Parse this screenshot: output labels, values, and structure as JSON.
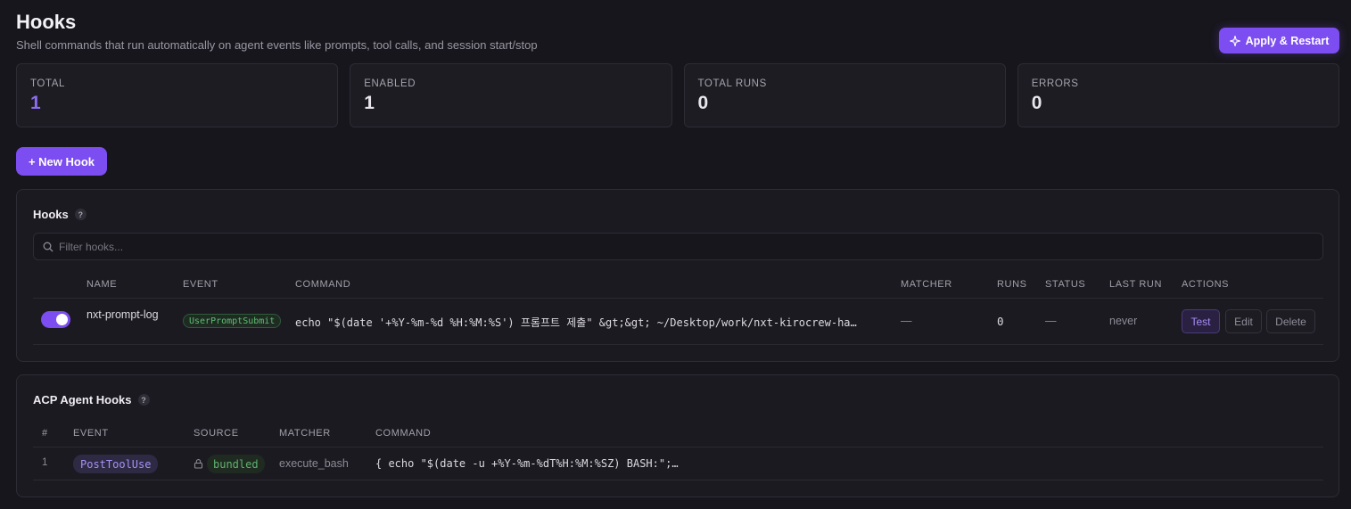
{
  "header": {
    "title": "Hooks",
    "subtitle": "Shell commands that run automatically on agent events like prompts, tool calls, and session start/stop",
    "apply_label": "Apply & Restart"
  },
  "stats": [
    {
      "label": "TOTAL",
      "value": "1"
    },
    {
      "label": "ENABLED",
      "value": "1"
    },
    {
      "label": "TOTAL RUNS",
      "value": "0"
    },
    {
      "label": "ERRORS",
      "value": "0"
    }
  ],
  "new_hook_label": "+ New Hook",
  "hooks_panel": {
    "title": "Hooks",
    "help": "?",
    "filter_placeholder": "Filter hooks...",
    "columns": [
      "NAME",
      "EVENT",
      "COMMAND",
      "MATCHER",
      "RUNS",
      "STATUS",
      "LAST RUN",
      "ACTIONS"
    ],
    "rows": [
      {
        "enabled": true,
        "name": "nxt-prompt-log",
        "event": "UserPromptSubmit",
        "command": "echo \"$(date '+%Y-%m-%d %H:%M:%S') 프롬프트 제출\" &gt;&gt; ~/Desktop/work/nxt-kirocrew-ha…",
        "matcher": "—",
        "runs": "0",
        "status": "—",
        "last_run": "never",
        "actions": {
          "test": "Test",
          "edit": "Edit",
          "delete": "Delete"
        }
      }
    ]
  },
  "acp_panel": {
    "title": "ACP Agent Hooks",
    "help": "?",
    "columns": [
      "#",
      "EVENT",
      "SOURCE",
      "MATCHER",
      "COMMAND"
    ],
    "rows": [
      {
        "index": "1",
        "event": "PostToolUse",
        "source": "bundled",
        "matcher": "execute_bash",
        "command": "{ echo \"$(date -u +%Y-%m-%dT%H:%M:%SZ) BASH:\";…"
      }
    ]
  },
  "colors": {
    "accent": "#7c4df0",
    "background": "#17161c",
    "panel": "#1b1a21",
    "success": "#5fbf72"
  },
  "icons": [
    "sparkle-icon",
    "search-icon",
    "help-icon",
    "lock-icon"
  ]
}
